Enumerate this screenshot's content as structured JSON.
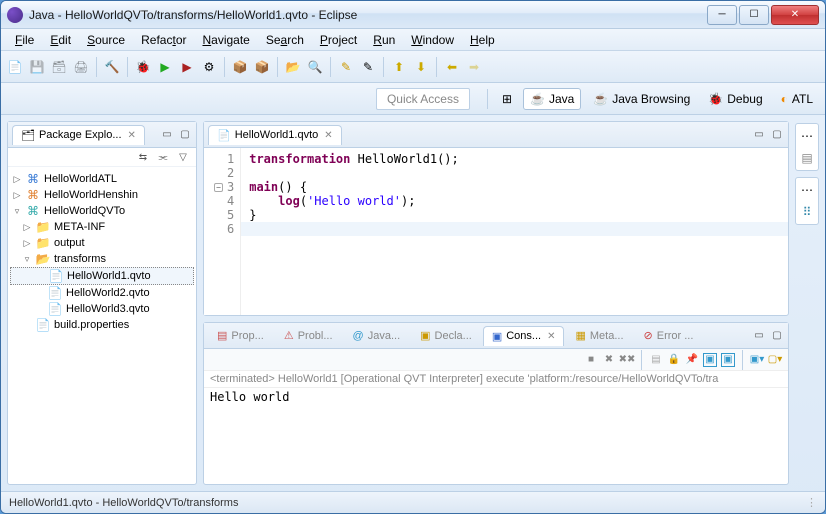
{
  "window": {
    "title": "Java - HelloWorldQVTo/transforms/HelloWorld1.qvto - Eclipse"
  },
  "menu": {
    "file": "File",
    "edit": "Edit",
    "source": "Source",
    "refactor": "Refactor",
    "navigate": "Navigate",
    "search": "Search",
    "project": "Project",
    "run": "Run",
    "window": "Window",
    "help": "Help"
  },
  "perspective": {
    "quick_access": "Quick Access",
    "java": "Java",
    "java_browsing": "Java Browsing",
    "debug": "Debug",
    "atl": "ATL"
  },
  "package_explorer": {
    "title": "Package Explo...",
    "projects": {
      "p1": "HelloWorldATL",
      "p2": "HelloWorldHenshin",
      "p3": "HelloWorldQVTo",
      "meta_inf": "META-INF",
      "output": "output",
      "transforms": "transforms",
      "f1": "HelloWorld1.qvto",
      "f2": "HelloWorld2.qvto",
      "f3": "HelloWorld3.qvto",
      "build": "build.properties"
    }
  },
  "editor": {
    "tab": "HelloWorld1.qvto",
    "lines": [
      "1",
      "2",
      "3",
      "4",
      "5",
      "6"
    ],
    "code": {
      "kw_transformation": "transformation",
      "transform_name": " HelloWorld1();",
      "kw_main": "main",
      "main_rest": "() {",
      "indent": "    ",
      "kw_log": "log",
      "log_open": "(",
      "str": "'Hello world'",
      "log_close": ");",
      "brace": "}"
    }
  },
  "bottom_tabs": {
    "properties": "Prop...",
    "problems": "Probl...",
    "javadoc": "Java...",
    "declaration": "Decla...",
    "console": "Cons...",
    "metadata": "Meta...",
    "error": "Error ..."
  },
  "console": {
    "status": "<terminated> HelloWorld1 [Operational QVT Interpreter] execute 'platform:/resource/HelloWorldQVTo/tra",
    "output": "Hello world"
  },
  "statusbar": {
    "text": "HelloWorld1.qvto - HelloWorldQVTo/transforms"
  }
}
